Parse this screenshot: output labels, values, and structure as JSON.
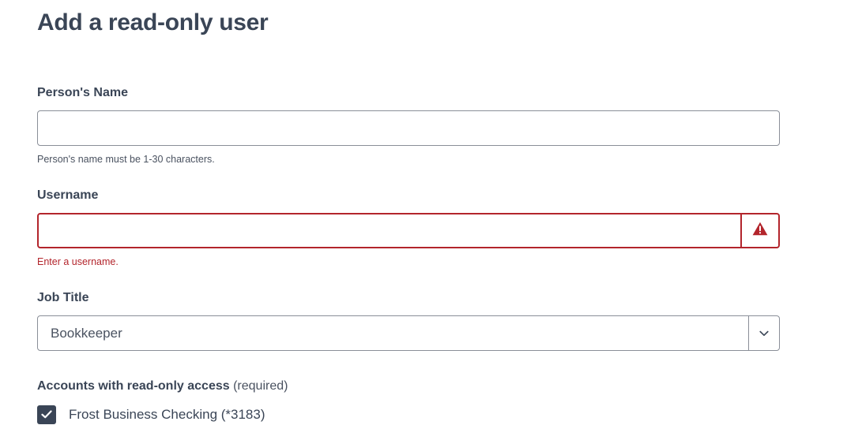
{
  "page": {
    "title": "Add a read-only user"
  },
  "fields": {
    "name": {
      "label": "Person's Name",
      "value": "",
      "helper": "Person's name must be 1-30 characters."
    },
    "username": {
      "label": "Username",
      "value": "",
      "error": "Enter a username.",
      "error_icon": "warning-triangle-icon"
    },
    "job_title": {
      "label": "Job Title",
      "selected": "Bookkeeper",
      "icon": "chevron-down-icon"
    }
  },
  "accounts": {
    "label": "Accounts with read-only access",
    "qualifier": "(required)",
    "items": [
      {
        "label": "Frost Business Checking (*3183)",
        "checked": true
      }
    ]
  },
  "colors": {
    "text": "#3a4556",
    "error": "#b3252c",
    "border": "#8a8f98",
    "checkbox": "#3a4556"
  }
}
